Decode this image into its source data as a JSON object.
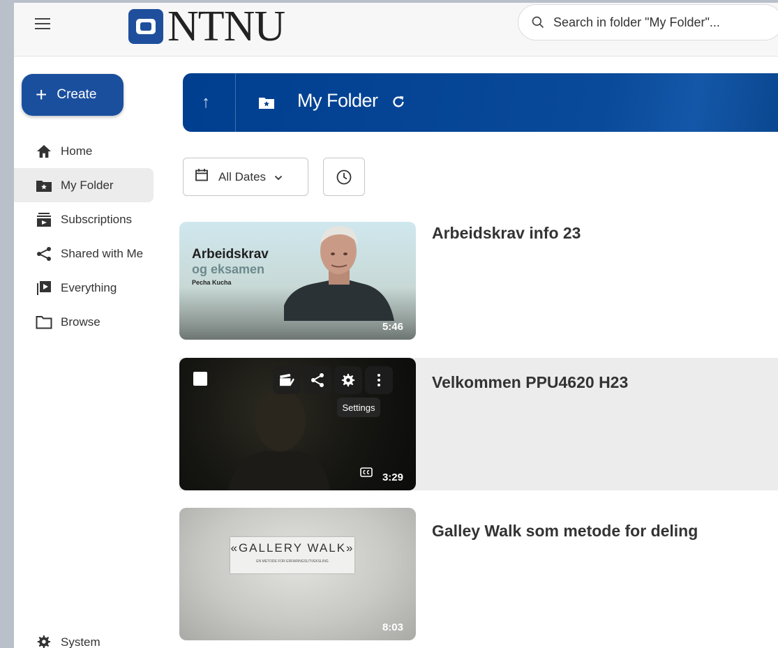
{
  "header": {
    "logo_text": "NTNU",
    "search_placeholder": "Search in folder \"My Folder\"..."
  },
  "sidebar": {
    "create_label": "Create",
    "items": [
      {
        "label": "Home",
        "icon": "home-icon"
      },
      {
        "label": "My Folder",
        "icon": "folder-star-icon",
        "active": true
      },
      {
        "label": "Subscriptions",
        "icon": "subscriptions-icon"
      },
      {
        "label": "Shared with Me",
        "icon": "share-icon"
      },
      {
        "label": "Everything",
        "icon": "video-library-icon"
      },
      {
        "label": "Browse",
        "icon": "folder-icon"
      }
    ],
    "system_label": "System"
  },
  "folder": {
    "title": "My Folder"
  },
  "filters": {
    "dates_label": "All Dates"
  },
  "videos": [
    {
      "title": "Arbeidskrav info 23",
      "duration": "5:46",
      "thumb_line1": "Arbeidskrav",
      "thumb_line2": "og eksamen",
      "thumb_line3": "Pecha Kucha"
    },
    {
      "title": "Velkommen PPU4620 H23",
      "duration": "3:29",
      "tooltip": "Settings"
    },
    {
      "title": "Galley Walk som metode for deling",
      "duration": "8:03",
      "thumb_line1": "«GALLERY WALK»",
      "thumb_line2": "EN METODE FOR ERFARINGSUTVEKSLING"
    }
  ],
  "colors": {
    "brand_blue": "#1a4f9e",
    "folder_bar": "#003e8f"
  }
}
